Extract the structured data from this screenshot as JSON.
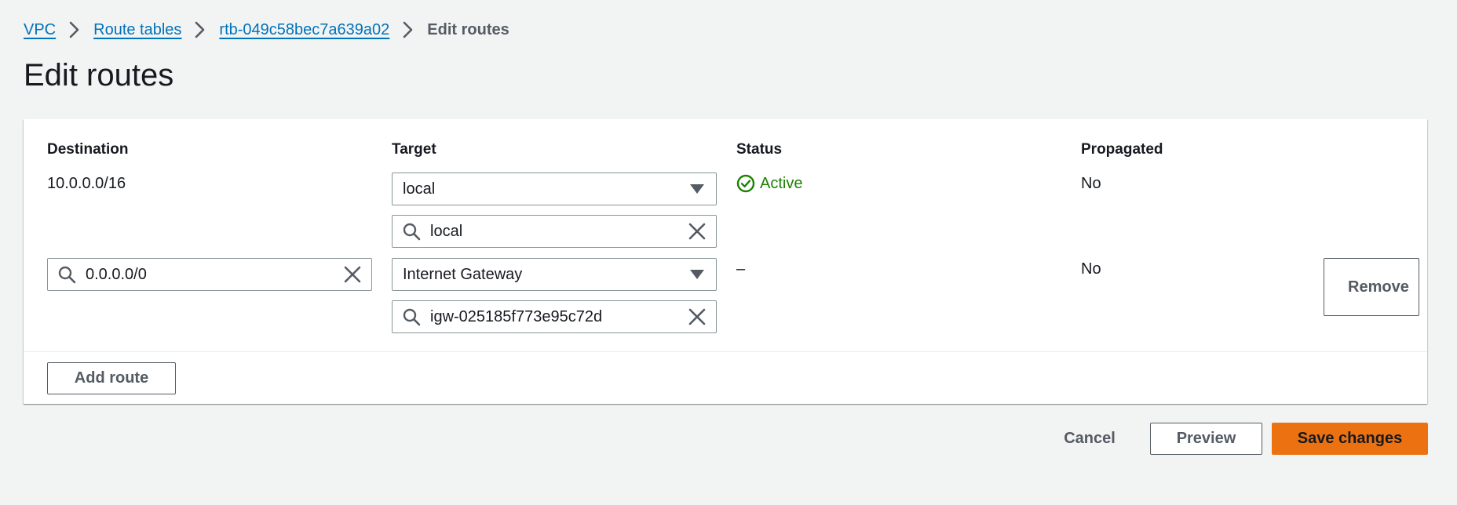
{
  "breadcrumb": {
    "items": [
      {
        "label": "VPC"
      },
      {
        "label": "Route tables"
      },
      {
        "label": "rtb-049c58bec7a639a02"
      }
    ],
    "current": "Edit routes"
  },
  "page": {
    "title": "Edit routes"
  },
  "table": {
    "headers": {
      "destination": "Destination",
      "target": "Target",
      "status": "Status",
      "propagated": "Propagated"
    },
    "rows": [
      {
        "destination": "10.0.0.0/16",
        "target_type": "local",
        "target_search": "local",
        "status": "Active",
        "propagated": "No"
      },
      {
        "destination": "0.0.0.0/0",
        "target_type": "Internet Gateway",
        "target_search": "igw-025185f773e95c72d",
        "status": "–",
        "propagated": "No",
        "remove_label": "Remove"
      }
    ]
  },
  "actions": {
    "add_route": "Add route",
    "cancel": "Cancel",
    "preview": "Preview",
    "save": "Save changes"
  },
  "colors": {
    "link": "#0073bb",
    "active_status": "#1d8102",
    "primary_button": "#ec7211",
    "page_background": "#f2f3f3"
  },
  "icons": {
    "breadcrumb_separator": "chevron-right-icon",
    "search": "search-icon",
    "clear": "close-icon",
    "dropdown": "caret-down-icon",
    "status": "check-circle-icon"
  }
}
